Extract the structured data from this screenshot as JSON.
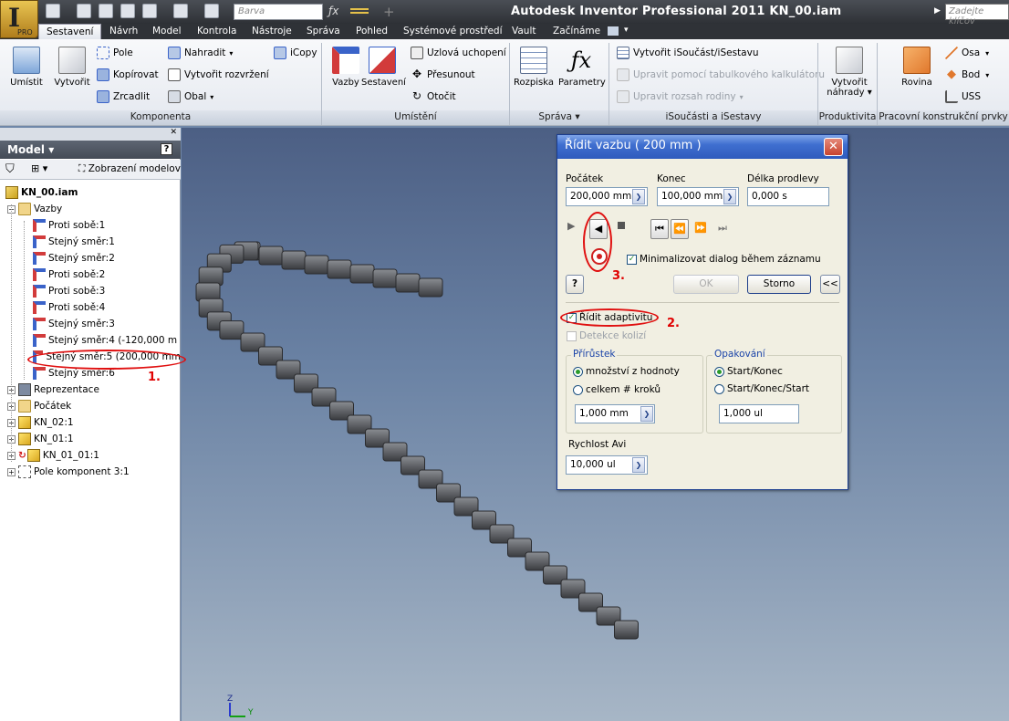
{
  "window": {
    "title": "Autodesk Inventor Professional 2011     KN_00.iam",
    "help_search_placeholder": "Zadejte klíčov"
  },
  "app_button": {
    "logo": "I",
    "edition": "PRO"
  },
  "quick_access": {
    "color_combo": "Barva"
  },
  "tabs": [
    "Sestavení",
    "Návrh",
    "Model",
    "Kontrola",
    "Nástroje",
    "Správa",
    "Pohled",
    "Systémové prostředí",
    "Vault",
    "Začínáme"
  ],
  "active_tab": "Sestavení",
  "ribbon": {
    "komponenta": {
      "label": "Komponenta",
      "umistit": "Umístit",
      "vytvorit": "Vytvořit",
      "pole": "Pole",
      "kopirovat": "Kopírovat",
      "zrcadlit": "Zrcadlit",
      "nahradit": "Nahradit",
      "vytvorit_rozvrzeni": "Vytvořit rozvržení",
      "obal": "Obal",
      "icopy": "iCopy"
    },
    "umisteni": {
      "label": "Umístění",
      "vazby": "Vazby",
      "sestaveni": "Sestavení",
      "uzlova_uchopeni": "Uzlová uchopení",
      "presunout": "Přesunout",
      "otocit": "Otočit"
    },
    "sprava": {
      "label": "Správa",
      "rozpiska": "Rozpiska",
      "parametry": "Parametry"
    },
    "isoucasti": {
      "label": "iSoučásti a iSestavy",
      "vytvorit": "Vytvořit iSoučást/iSestavu",
      "upravit_tab": "Upravit pomocí tabulkového kalkulátoru",
      "upravit_rozsah": "Upravit rozsah rodiny"
    },
    "produktivita": {
      "label": "Produktivita",
      "vytvorit_nahrady_1": "Vytvořit",
      "vytvorit_nahrady_2": "náhrady"
    },
    "pracovni": {
      "label": "Pracovní konstrukční prvky",
      "rovina": "Rovina",
      "osa": "Osa",
      "bod": "Bod",
      "uss": "USS"
    }
  },
  "browser": {
    "title": "Model",
    "view_label": "Zobrazení modelov",
    "root": "KN_00.iam",
    "vazby_folder": "Vazby",
    "constraints": [
      {
        "label": "Proti sobě:1",
        "icon": "mate-icon"
      },
      {
        "label": "Stejný směr:1",
        "icon": "flush-icon"
      },
      {
        "label": "Stejný směr:2",
        "icon": "flush-icon"
      },
      {
        "label": "Proti sobě:2",
        "icon": "mate-icon"
      },
      {
        "label": "Proti sobě:3",
        "icon": "angle-mate-icon"
      },
      {
        "label": "Proti sobě:4",
        "icon": "mate-icon"
      },
      {
        "label": "Stejný směr:3",
        "icon": "flush-icon"
      },
      {
        "label": "Stejný směr:4 (-120,000 m",
        "icon": "flush-icon"
      },
      {
        "label": "Stejný směr:5 (200,000 mm",
        "icon": "flush-icon"
      },
      {
        "label": "Stejný směr:6",
        "icon": "flush-icon"
      }
    ],
    "other_nodes": [
      {
        "label": "Reprezentace",
        "icon": "representation-icon"
      },
      {
        "label": "Počátek",
        "icon": "folder-icon"
      },
      {
        "label": "KN_02:1",
        "icon": "part-icon"
      },
      {
        "label": "KN_01:1",
        "icon": "part-icon"
      },
      {
        "label": "KN_01_01:1",
        "icon": "adaptive-part-icon"
      },
      {
        "label": "Pole komponent 3:1",
        "icon": "pattern-icon"
      }
    ]
  },
  "dialog": {
    "title": "Řídit vazbu     ( 200 mm )",
    "start_label": "Počátek",
    "start_value": "200,000 mm",
    "end_label": "Konec",
    "end_value": "100,000 mm",
    "pause_label": "Délka prodlevy",
    "pause_value": "0,000 s",
    "minimize_label": "Minimalizovat dialog během záznamu",
    "ok": "OK",
    "cancel": "Storno",
    "more": "<<",
    "help": "?",
    "adaptivity_label": "Řídit adaptivitu",
    "collision_label": "Detekce kolizí",
    "increment_group": "Přírůstek",
    "inc_value_label": "množství z hodnoty",
    "inc_steps_label": "celkem # kroků",
    "inc_value": "1,000 mm",
    "repeat_group": "Opakování",
    "rep_start_end": "Start/Konec",
    "rep_start_end_start": "Start/Konec/Start",
    "rep_value": "1,000 ul",
    "avi_label": "Rychlost Avi",
    "avi_value": "10,000 ul"
  },
  "annotations": {
    "one": "1.",
    "two": "2.",
    "three": "3."
  },
  "viewcube": {
    "z": "Z",
    "y": "Y"
  },
  "colors": {
    "annotation": "#e00000",
    "dialog_title": "#2f5bbd",
    "viewport_top": "#4c5f84"
  }
}
